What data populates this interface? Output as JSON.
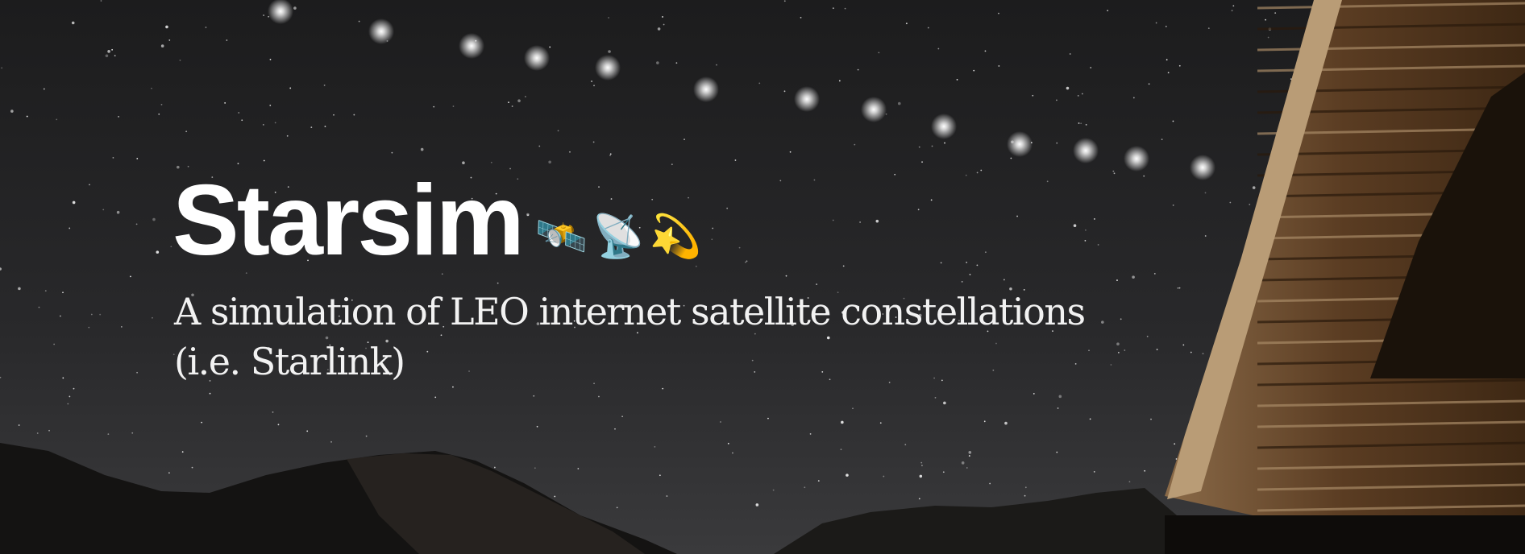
{
  "banner": {
    "title": "Starsim",
    "emojis": "🛰️📡💫",
    "emoji_icons": [
      "satellite-icon",
      "satellite-dish-icon",
      "dizzy-star-icon"
    ],
    "subtitle_line1": "A simulation of LEO internet satellite constellations",
    "subtitle_line2": "(i.e. Starlink)"
  },
  "colors": {
    "sky": "#232324",
    "text": "#ffffff",
    "wood": "#6b4a2c"
  }
}
